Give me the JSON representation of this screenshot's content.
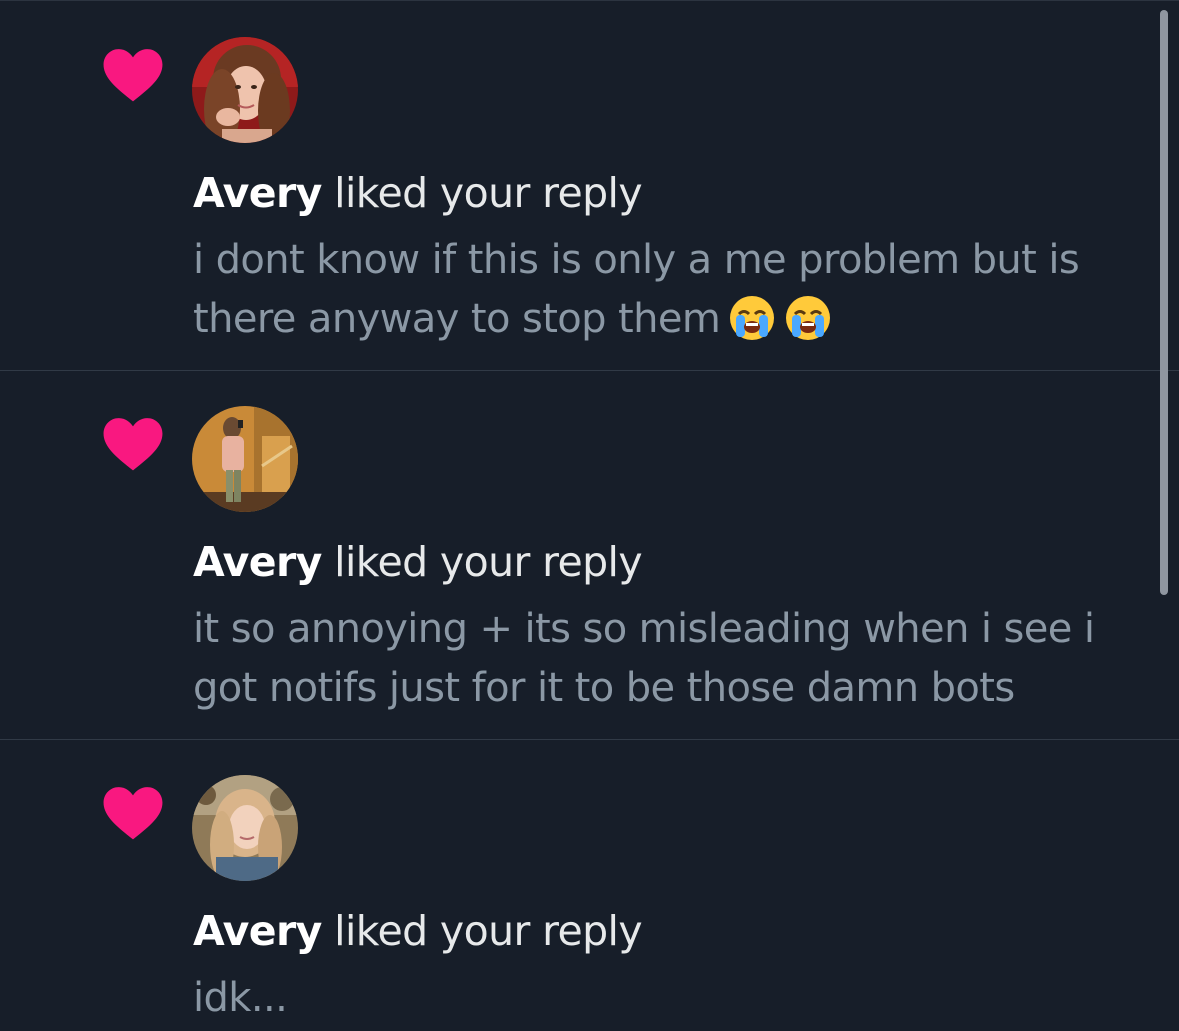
{
  "notifications": [
    {
      "user_name": "Avery",
      "action_text": " liked your reply",
      "reply_lines": [
        "i dont know if this is only a me problem but is",
        "there anyway to stop them"
      ],
      "emojis": [
        "loudly-crying-face",
        "loudly-crying-face"
      ],
      "icon": "heart-icon",
      "avatar": "avatar-photo"
    },
    {
      "user_name": "Avery",
      "action_text": " liked your reply",
      "reply_lines": [
        "it so annoying + its so misleading when i see i",
        "got notifs just for it to be those damn bots"
      ],
      "icon": "heart-icon",
      "avatar": "avatar-photo"
    },
    {
      "user_name": "Avery",
      "action_text": " liked your reply",
      "reply_lines": [
        "idk..."
      ],
      "icon": "heart-icon",
      "avatar": "avatar-photo"
    }
  ],
  "colors": {
    "background": "#171e29",
    "heart": "#f91880",
    "primary_text": "#e7e9ea",
    "secondary_text": "#8b98a5",
    "divider": "#313a46"
  }
}
